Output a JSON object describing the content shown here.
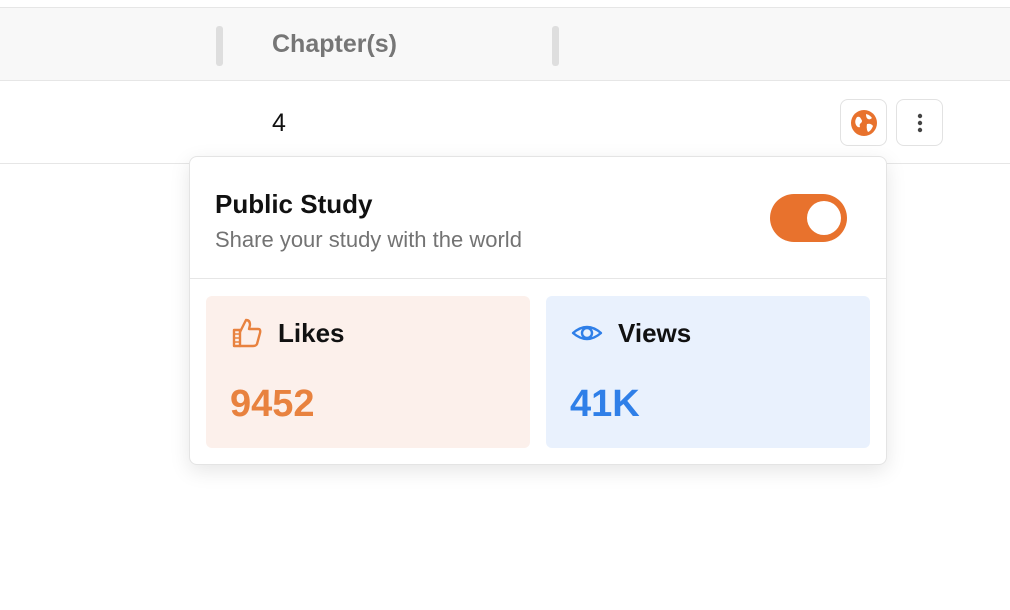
{
  "table": {
    "columns": [
      "Chapter(s)"
    ],
    "rows": [
      {
        "chapters": "4"
      }
    ]
  },
  "row_actions": {
    "globe_icon": "globe-icon",
    "more_icon": "more-vertical-icon"
  },
  "popover": {
    "title": "Public Study",
    "subtitle": "Share your study with the world",
    "toggle_on": true,
    "toggle_color": "#e8722d",
    "stats": {
      "likes": {
        "label": "Likes",
        "value": "9452",
        "icon": "thumbs-up-icon",
        "color": "#e8823f",
        "bg": "#fcf0eb"
      },
      "views": {
        "label": "Views",
        "value": "41K",
        "icon": "eye-icon",
        "color": "#2f7fe8",
        "bg": "#e9f1fd"
      }
    }
  }
}
